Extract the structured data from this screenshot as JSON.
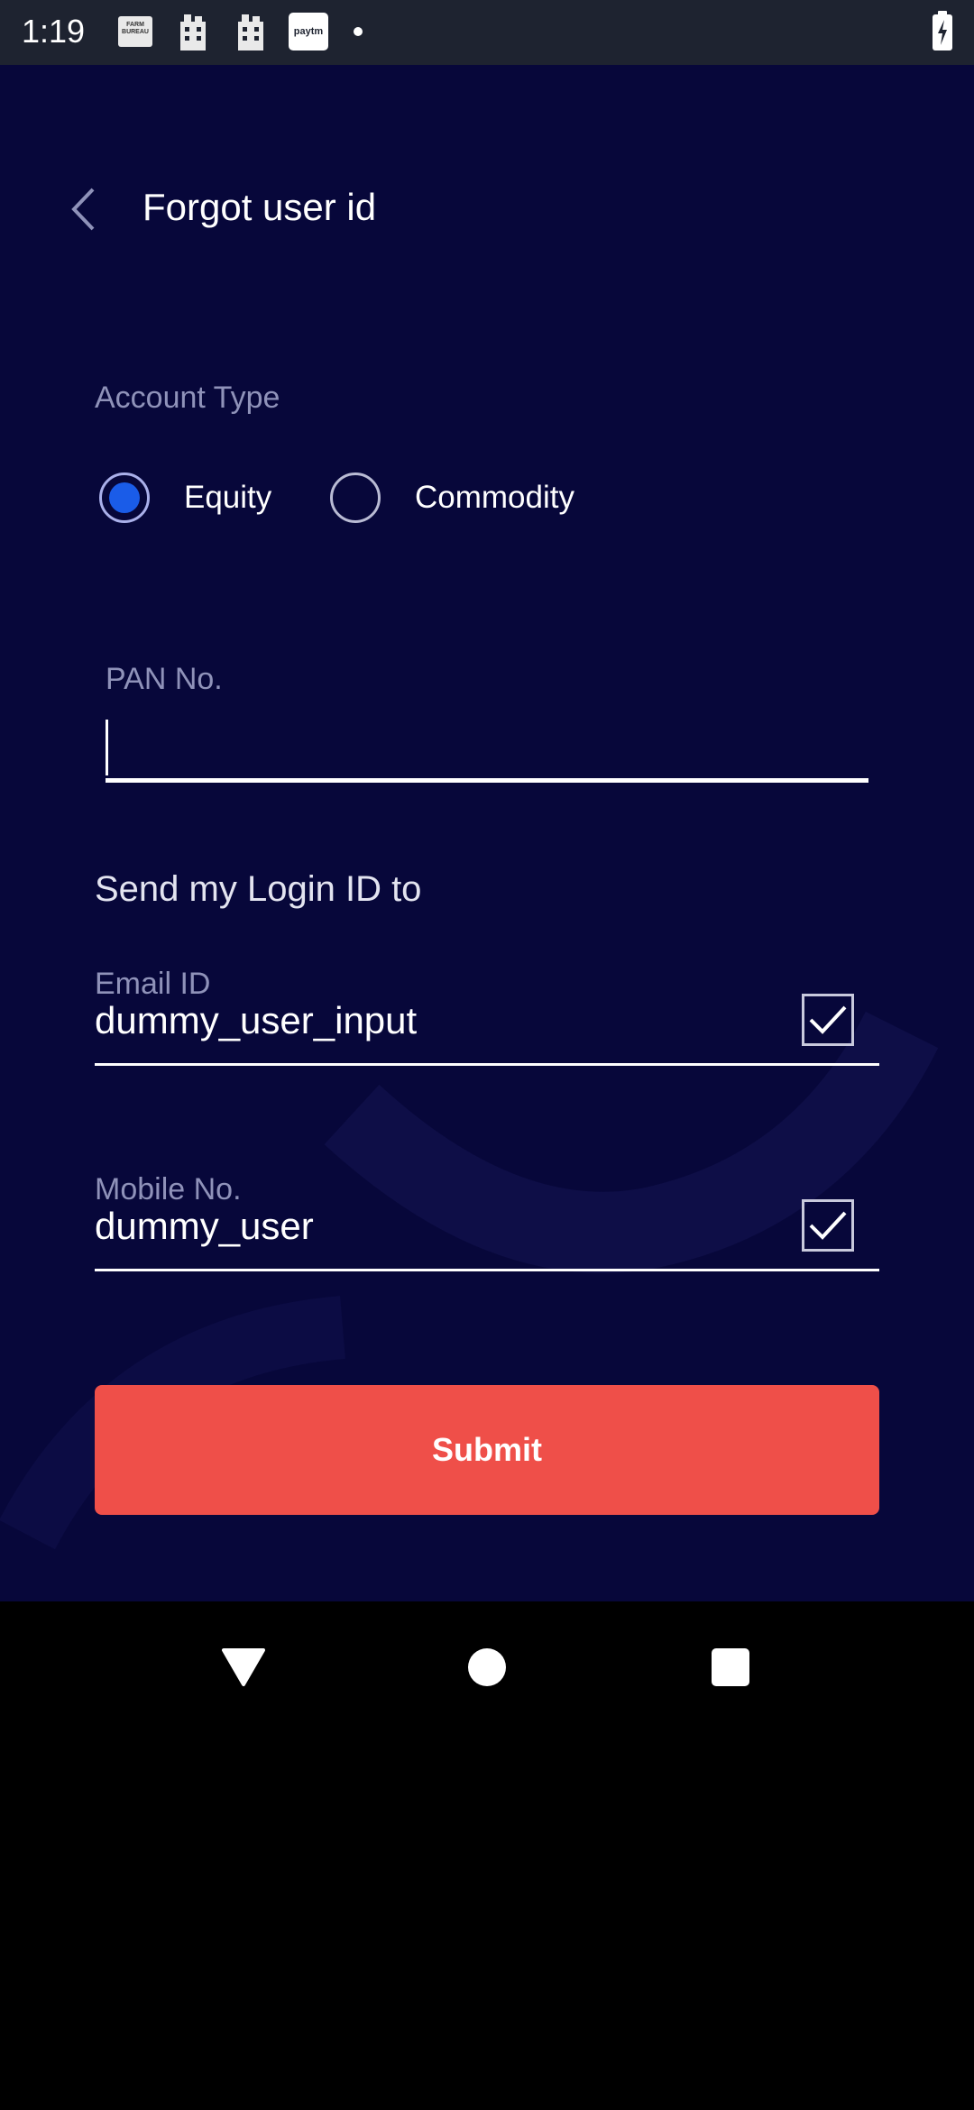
{
  "status_bar": {
    "time": "1:19",
    "notifications": [
      "farm-bureau-icon",
      "building-icon",
      "building-icon",
      "paytm-icon",
      "dot-icon"
    ],
    "notif_box_text": "FARM BUREAU",
    "paytm_text": "paytm",
    "battery": "battery-charging-icon"
  },
  "header": {
    "title": "Forgot user id",
    "back_icon": "back-chevron-icon"
  },
  "account_type": {
    "label": "Account Type",
    "options": [
      {
        "label": "Equity",
        "selected": true
      },
      {
        "label": "Commodity",
        "selected": false
      }
    ]
  },
  "pan": {
    "label": "PAN No.",
    "value": ""
  },
  "send_to": {
    "label": "Send my Login ID to",
    "email": {
      "label": "Email ID",
      "value": "dummy_user_input",
      "checked": true
    },
    "mobile": {
      "label": "Mobile No.",
      "value": "dummy_user",
      "checked": true
    }
  },
  "submit": {
    "label": "Submit"
  },
  "colors": {
    "background": "#07073a",
    "accent": "#ef4f49",
    "radio_selected": "#1a5ce8",
    "muted_text": "#8f92b9"
  },
  "nav": [
    "back-triangle-icon",
    "home-circle-icon",
    "recents-square-icon"
  ]
}
